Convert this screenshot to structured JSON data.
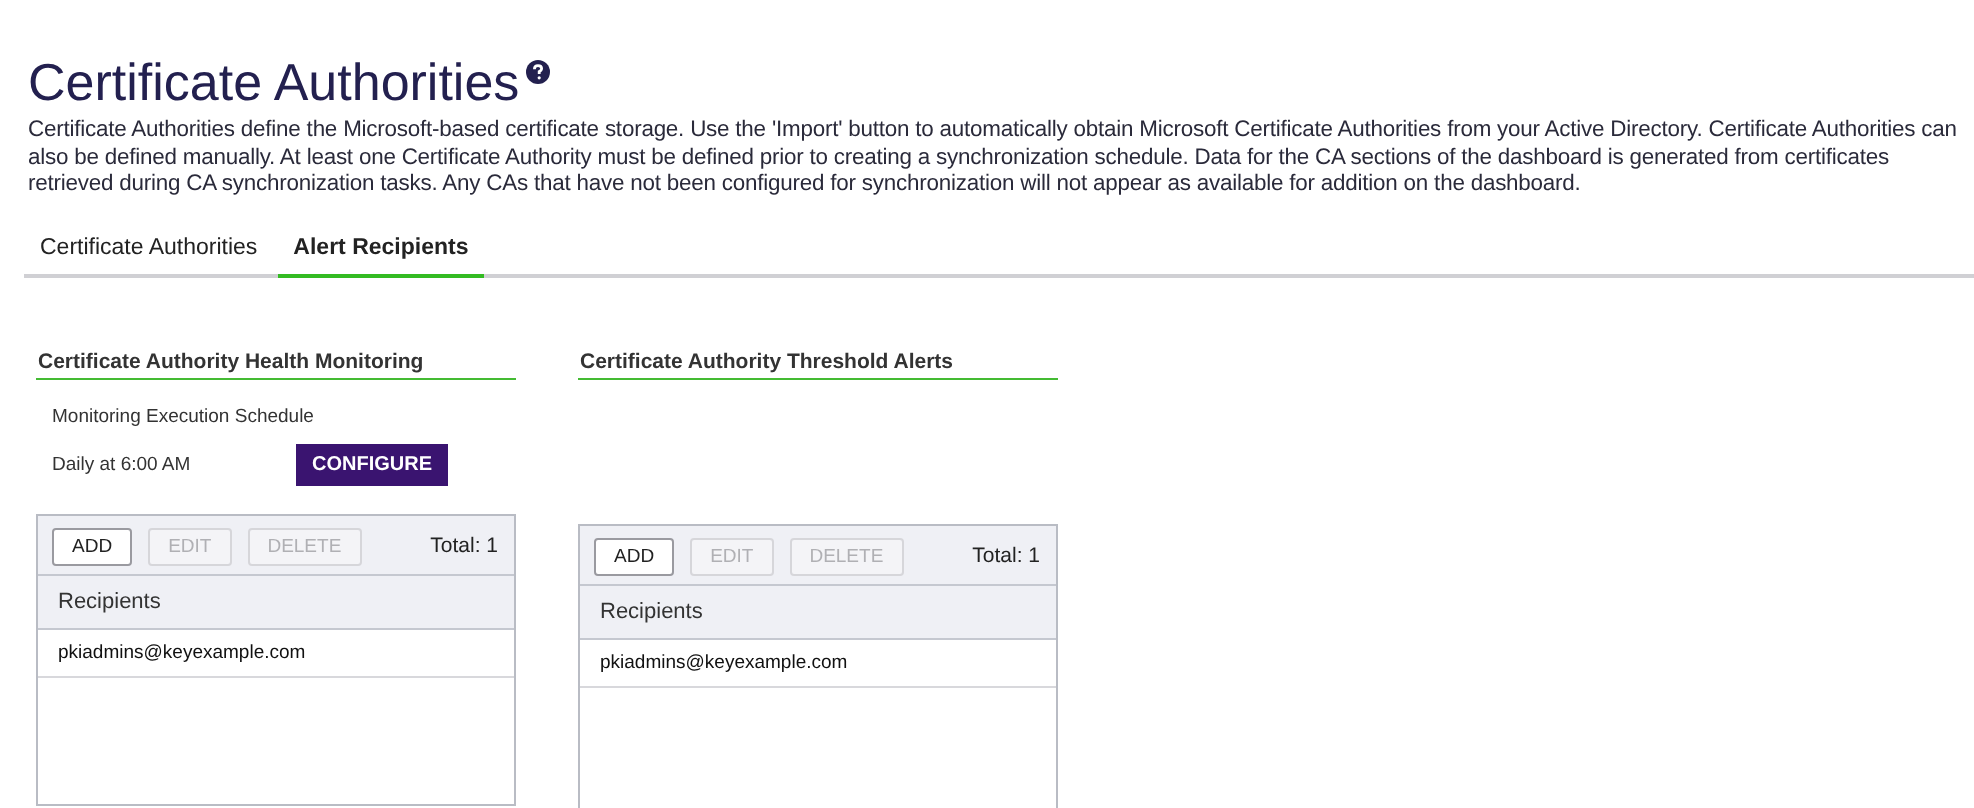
{
  "page": {
    "title": "Certificate Authorities",
    "description": "Certificate Authorities define the Microsoft-based certificate storage. Use the 'Import' button to automatically obtain Microsoft Certificate Authorities from your Active Directory. Certificate Authorities can also be defined manually. At least one Certificate Authority must be defined prior to creating a synchronization schedule. Data for the CA sections of the dashboard is generated from certificates retrieved during CA synchronization tasks. Any CAs that have not been configured for synchronization will not appear as available for addition on the dashboard."
  },
  "tabs": [
    {
      "label": "Certificate Authorities",
      "selected": false
    },
    {
      "label": "Alert Recipients",
      "selected": true
    }
  ],
  "panels": [
    {
      "title": "Certificate Authority Health Monitoring",
      "schedule": {
        "label": "Monitoring Execution Schedule",
        "value": "Daily at 6:00 AM",
        "button": "CONFIGURE"
      },
      "toolbar": [
        {
          "label": "ADD",
          "disabled": false
        },
        {
          "label": "EDIT",
          "disabled": true
        },
        {
          "label": "DELETE",
          "disabled": true
        }
      ],
      "total": "Total: 1",
      "column": "Recipients",
      "rows": [
        "pkiadmins@keyexample.com"
      ]
    },
    {
      "title": "Certificate Authority Threshold Alerts",
      "toolbar": [
        {
          "label": "ADD",
          "disabled": false
        },
        {
          "label": "EDIT",
          "disabled": true
        },
        {
          "label": "DELETE",
          "disabled": true
        }
      ],
      "total": "Total: 1",
      "column": "Recipients",
      "rows": [
        "pkiadmins@keyexample.com"
      ]
    }
  ]
}
